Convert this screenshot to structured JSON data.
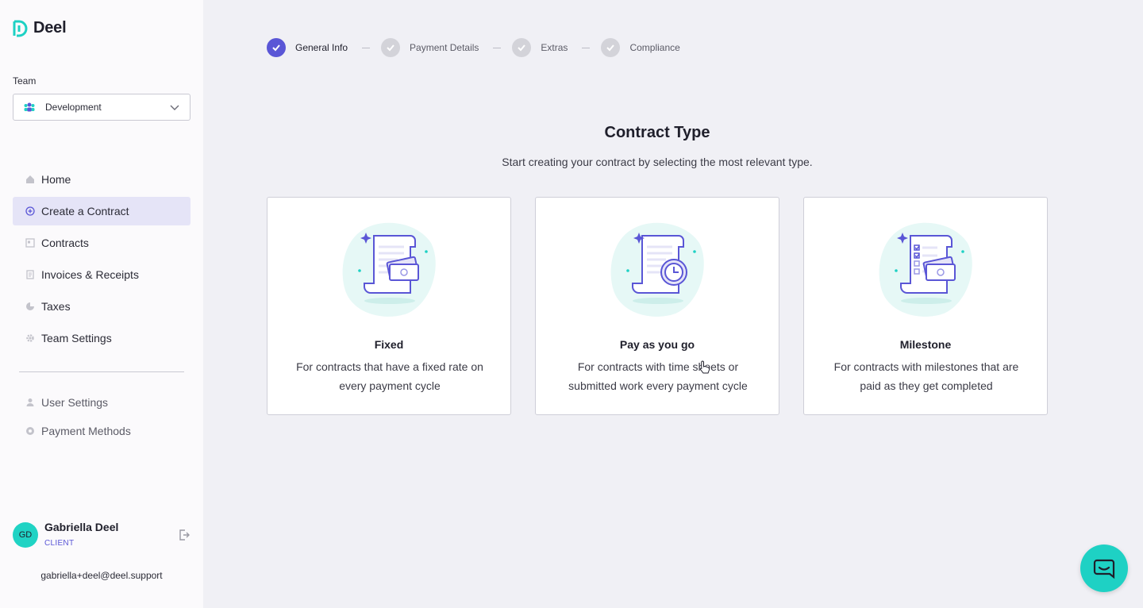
{
  "brand": {
    "name": "Deel"
  },
  "team": {
    "label": "Team",
    "value": "Development"
  },
  "nav": [
    {
      "label": "Home",
      "icon": "home-icon"
    },
    {
      "label": "Create a Contract",
      "icon": "plus-circle-icon",
      "active": true
    },
    {
      "label": "Contracts",
      "icon": "contract-icon"
    },
    {
      "label": "Invoices & Receipts",
      "icon": "invoice-icon"
    },
    {
      "label": "Taxes",
      "icon": "pie-chart-icon"
    },
    {
      "label": "Team Settings",
      "icon": "gear-icon"
    }
  ],
  "subnav": [
    {
      "label": "User Settings",
      "icon": "user-icon"
    },
    {
      "label": "Payment Methods",
      "icon": "payment-icon"
    }
  ],
  "user": {
    "initials": "GD",
    "name": "Gabriella Deel",
    "role": "CLIENT",
    "email": "gabriella+deel@deel.support"
  },
  "steps": [
    {
      "label": "General Info",
      "active": true
    },
    {
      "label": "Payment Details"
    },
    {
      "label": "Extras"
    },
    {
      "label": "Compliance"
    }
  ],
  "main": {
    "title": "Contract Type",
    "subtitle": "Start creating your contract by selecting the most relevant type."
  },
  "cards": [
    {
      "title": "Fixed",
      "desc": "For contracts that have a fixed rate on every payment cycle",
      "icon": "fixed-contract-icon"
    },
    {
      "title": "Pay as you go",
      "desc": "For contracts with time sheets or submitted work every payment cycle",
      "icon": "payg-contract-icon"
    },
    {
      "title": "Milestone",
      "desc": "For contracts with milestones that are paid as they get completed",
      "icon": "milestone-contract-icon"
    }
  ],
  "colors": {
    "accent": "#5a56d6",
    "teal": "#1ed1c4",
    "active_nav_bg": "#e5e4f7"
  }
}
